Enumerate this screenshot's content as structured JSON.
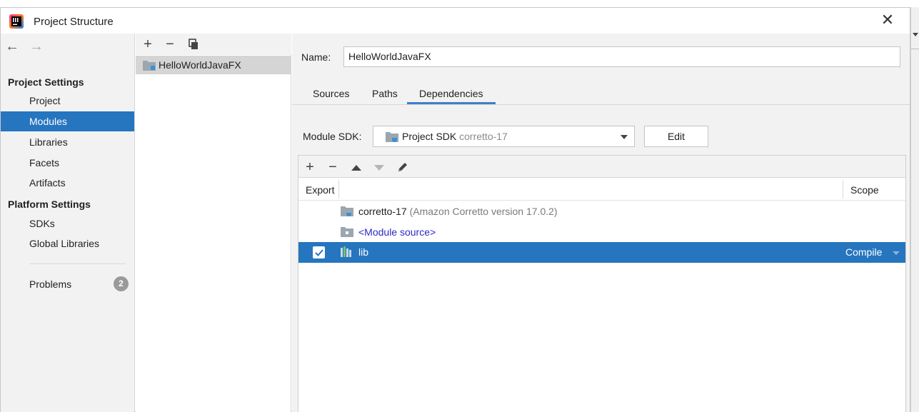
{
  "dialog": {
    "title": "Project Structure",
    "close_label": "✕"
  },
  "sidebar": {
    "back_label": "←",
    "forward_label": "→",
    "project_settings_heading": "Project Settings",
    "project_items": [
      {
        "label": "Project",
        "selected": false
      },
      {
        "label": "Modules",
        "selected": true
      },
      {
        "label": "Libraries",
        "selected": false
      },
      {
        "label": "Facets",
        "selected": false
      },
      {
        "label": "Artifacts",
        "selected": false
      }
    ],
    "platform_settings_heading": "Platform Settings",
    "platform_items": [
      {
        "label": "SDKs"
      },
      {
        "label": "Global Libraries"
      }
    ],
    "problems_label": "Problems",
    "problems_count": "2"
  },
  "modules": {
    "add_label": "+",
    "remove_label": "−",
    "items": [
      {
        "label": "HelloWorldJavaFX",
        "selected": true
      }
    ]
  },
  "main": {
    "name_label": "Name:",
    "name_value": "HelloWorldJavaFX",
    "tabs": [
      {
        "label": "Sources",
        "active": false
      },
      {
        "label": "Paths",
        "active": false
      },
      {
        "label": "Dependencies",
        "active": true
      }
    ],
    "sdk_label": "Module SDK:",
    "sdk_value_main": "Project SDK",
    "sdk_value_dim": "corretto-17",
    "edit_label": "Edit",
    "dependencies": {
      "toolbar": {
        "add": "+",
        "remove": "−"
      },
      "columns": {
        "export": "Export",
        "scope": "Scope"
      },
      "rows": [
        {
          "name": "corretto-17",
          "detail": "(Amazon Corretto version 17.0.2)",
          "icon": "sdk-folder-icon",
          "checkbox": false,
          "scope": "",
          "selected": false
        },
        {
          "name": "<Module source>",
          "detail": "",
          "icon": "source-folder-icon",
          "checkbox": false,
          "scope": "",
          "selected": false
        },
        {
          "name": "lib",
          "detail": "",
          "icon": "library-icon",
          "checkbox": true,
          "scope": "Compile",
          "selected": true
        }
      ]
    }
  },
  "colors": {
    "selection": "#2675bf",
    "panel_bg": "#f2f2f2",
    "link": "#2a2ac9"
  }
}
